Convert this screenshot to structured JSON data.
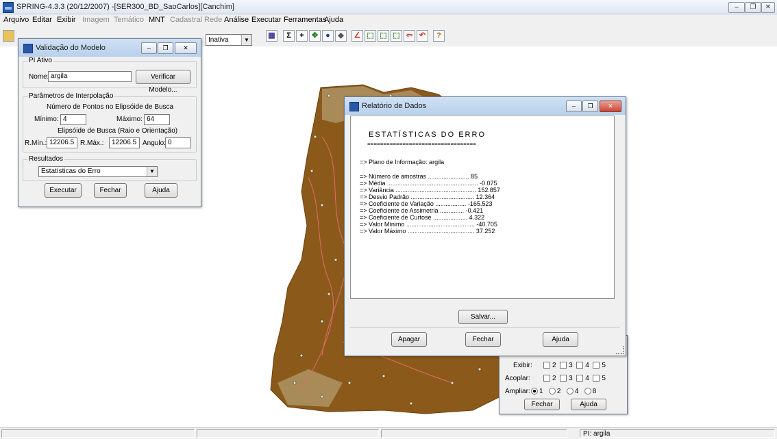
{
  "app": {
    "title": "SPRING-4.3.3 (20/12/2007) -[SER300_BD_SaoCarlos][Canchim]",
    "menu": [
      "Arquivo",
      "Editar",
      "Exibir",
      "Imagem",
      "Temático",
      "MNT",
      "Cadastral",
      "Rede",
      "Análise",
      "Executar",
      "Ferramentas",
      "Ajuda"
    ],
    "disabled_menu": [
      "Imagem",
      "Temático",
      "Cadastral",
      "Rede"
    ],
    "toolbar_combo": "Inativa"
  },
  "validacao": {
    "title": "Validação do Modelo",
    "pi_group": "PI Ativo",
    "nome_label": "Nome:",
    "nome_value": "argila",
    "verificar_button": "Verificar Modelo...",
    "param_group": "Parâmetros de Interpolação",
    "pontos_label": "Número de Pontos no Elipsóide de Busca",
    "minimo_label": "Mínimo:",
    "minimo_value": "4",
    "maximo_label": "Máximo:",
    "maximo_value": "64",
    "elipsoide_label": "Elipsóide de Busca (Raio e Orientação)",
    "rmin_label": "R.Mín.:",
    "rmin_value": "12206.5",
    "rmax_label": "R.Máx.:",
    "rmax_value": "12206.5",
    "angulo_label": "Angulo:",
    "angulo_value": "0",
    "resultados_group": "Resultados",
    "resultados_select": "Estatísticas do Erro",
    "executar_button": "Executar",
    "fechar_button": "Fechar",
    "ajuda_button": "Ajuda"
  },
  "relatorio": {
    "title": "Relatório de Dados",
    "heading": "ESTATÍSTICAS DO ERRO",
    "underline": "==================================",
    "plano": "=> Plano de Informação: argila",
    "stats": [
      "=> Número de amostras ........................ 85",
      "=> Média ..................................................... -0.075",
      "=> Variância ............................................... 152.857",
      "=> Desvio Padrão ..................................... 12.364",
      "=> Coeficiente de Variação .................. -165.523",
      "=> Coeficiente de Assimetria .............. -0.421",
      "=> Coeficiente de Curtose .................... 4.322",
      "=> Valor Mínimo ........................................ -40.705",
      "=> Valor Máximo ....................................... 37.252"
    ],
    "salvar_button": "Salvar...",
    "apagar_button": "Apagar",
    "fechar_button": "Fechar",
    "ajuda_button": "Ajuda"
  },
  "painel": {
    "exibir_label": "Exibir:",
    "acoplar_label": "Acoplar:",
    "ampliar_label": "Ampliar:",
    "check_options": [
      "2",
      "3",
      "4",
      "5"
    ],
    "ampliar_options": [
      "1",
      "2",
      "4",
      "8"
    ],
    "fechar_button": "Fechar",
    "ajuda_button": "Ajuda"
  },
  "status": {
    "pi": "PI: argila"
  },
  "colors": {
    "map_fill": "#8b5a1b",
    "map_light": "#a98b5a",
    "contour": "#e36a6a"
  }
}
